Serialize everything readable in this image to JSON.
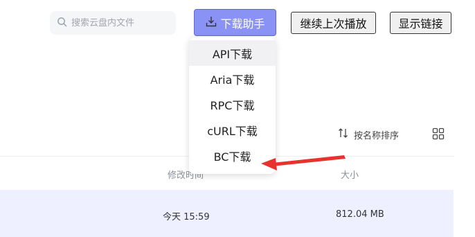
{
  "search": {
    "placeholder": "搜索云盘内文件"
  },
  "toolbar": {
    "assist_label": "下载助手",
    "continue_label": "继续上次播放",
    "link_label": "显示链接"
  },
  "dropdown": {
    "items": [
      "API下载",
      "Aria下载",
      "RPC下载",
      "cURL下载",
      "BC下载"
    ]
  },
  "list": {
    "sort_label": "按名称排序",
    "columns": {
      "modified": "修改时间",
      "size": "大小"
    },
    "rows": [
      {
        "modified": "今天 15:59",
        "size": "812.04 MB"
      }
    ]
  },
  "colors": {
    "accent": "#8a93f5",
    "annotation_arrow": "#e8322e",
    "selected_row": "#eff0ff"
  },
  "icons": [
    "search-icon",
    "download-icon",
    "sort-icon",
    "grid-view-icon",
    "annotation-arrow"
  ]
}
